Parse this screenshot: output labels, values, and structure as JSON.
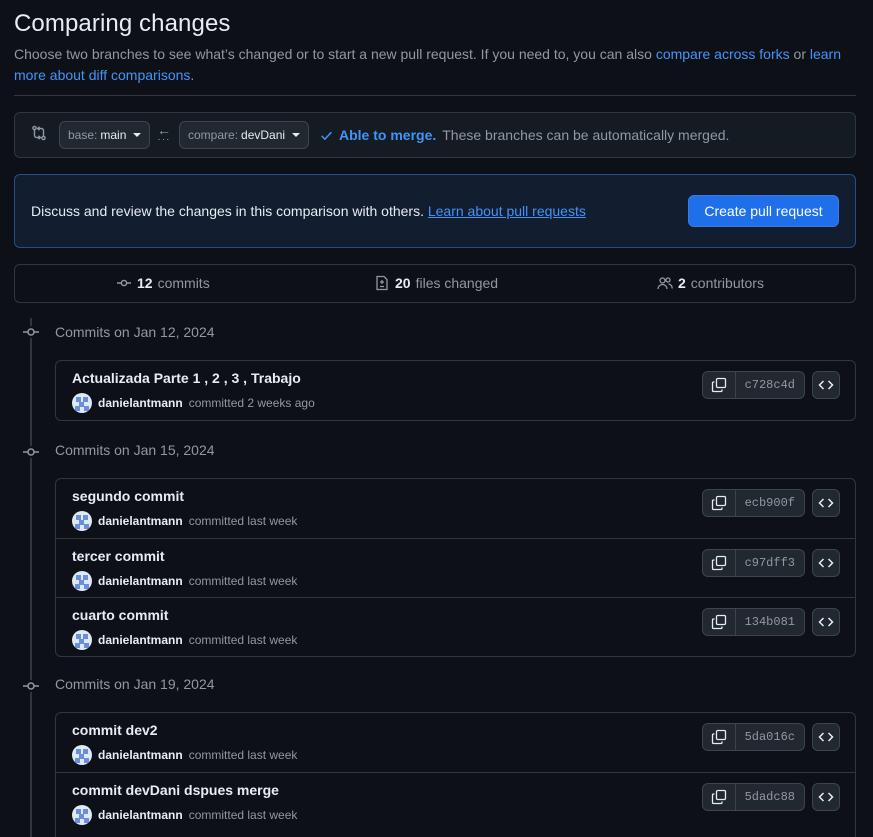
{
  "page": {
    "title": "Comparing changes",
    "subtitle_text": "Choose two branches to see what’s changed or to start a new pull request. If you need to, you can also ",
    "subtitle_link1": "compare across forks",
    "subtitle_or": " or ",
    "subtitle_link2": "learn more about diff comparisons",
    "subtitle_end": "."
  },
  "range": {
    "base_prefix": "base:",
    "base_value": "main",
    "compare_prefix": "compare:",
    "compare_value": "devDani",
    "merge_status": "Able to merge.",
    "merge_detail": "These branches can be automatically merged."
  },
  "banner": {
    "text": "Discuss and review the changes in this comparison with others.",
    "link": "Learn about pull requests",
    "button": "Create pull request"
  },
  "stats": {
    "commits_count": "12",
    "commits_label": "commits",
    "files_count": "20",
    "files_label": "files changed",
    "contributors_count": "2",
    "contributors_label": "contributors"
  },
  "groups": [
    {
      "label": "Commits on Jan 12, 2024",
      "commits": [
        {
          "message": "Actualizada Parte 1 , 2 , 3 , Trabajo",
          "author": "danielantmann",
          "when": "committed 2 weeks ago",
          "sha": "c728c4d"
        }
      ]
    },
    {
      "label": "Commits on Jan 15, 2024",
      "commits": [
        {
          "message": "segundo commit",
          "author": "danielantmann",
          "when": "committed last week",
          "sha": "ecb900f"
        },
        {
          "message": "tercer commit",
          "author": "danielantmann",
          "when": "committed last week",
          "sha": "c97dff3"
        },
        {
          "message": "cuarto commit",
          "author": "danielantmann",
          "when": "committed last week",
          "sha": "134b081"
        }
      ]
    },
    {
      "label": "Commits on Jan 19, 2024",
      "commits": [
        {
          "message": "commit dev2",
          "author": "danielantmann",
          "when": "committed last week",
          "sha": "5da016c"
        },
        {
          "message": "commit devDani dspues merge",
          "author": "danielantmann",
          "when": "committed last week",
          "sha": "5dadc88"
        }
      ]
    }
  ],
  "colors": {
    "background": "#0d1117",
    "accent": "#4493f8",
    "primary_button": "#1f6feb",
    "border": "#30363d",
    "muted_text": "#9198a1"
  },
  "icons": {
    "range": "git-compare-icon",
    "merge": "check-icon",
    "commits": "git-commit-icon",
    "files": "file-diff-icon",
    "contributors": "people-icon",
    "copy": "copy-icon",
    "browse": "code-icon"
  }
}
